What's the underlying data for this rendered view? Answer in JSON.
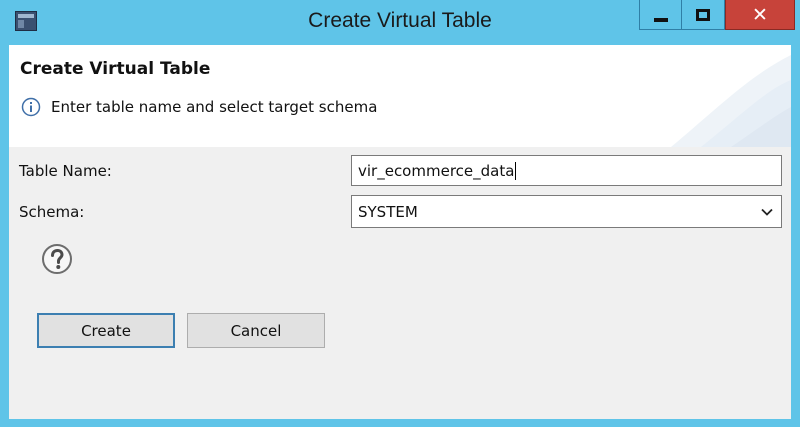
{
  "window": {
    "title": "Create Virtual Table",
    "controls": {
      "minimize_icon": "minimize-icon",
      "maximize_icon": "maximize-icon",
      "close_icon": "close-icon"
    }
  },
  "header": {
    "title": "Create Virtual Table",
    "message": "Enter table name and select target schema",
    "message_icon": "info-icon"
  },
  "form": {
    "table_name": {
      "label": "Table Name:",
      "value": "vir_ecommerce_data"
    },
    "schema": {
      "label": "Schema:",
      "selected": "SYSTEM"
    }
  },
  "help": {
    "icon": "help-icon"
  },
  "buttons": {
    "create_label": "Create",
    "cancel_label": "Cancel"
  },
  "colors": {
    "title_bar": "#5fc4e8",
    "close_button": "#c7433a",
    "default_button_border": "#3c7fb1"
  }
}
